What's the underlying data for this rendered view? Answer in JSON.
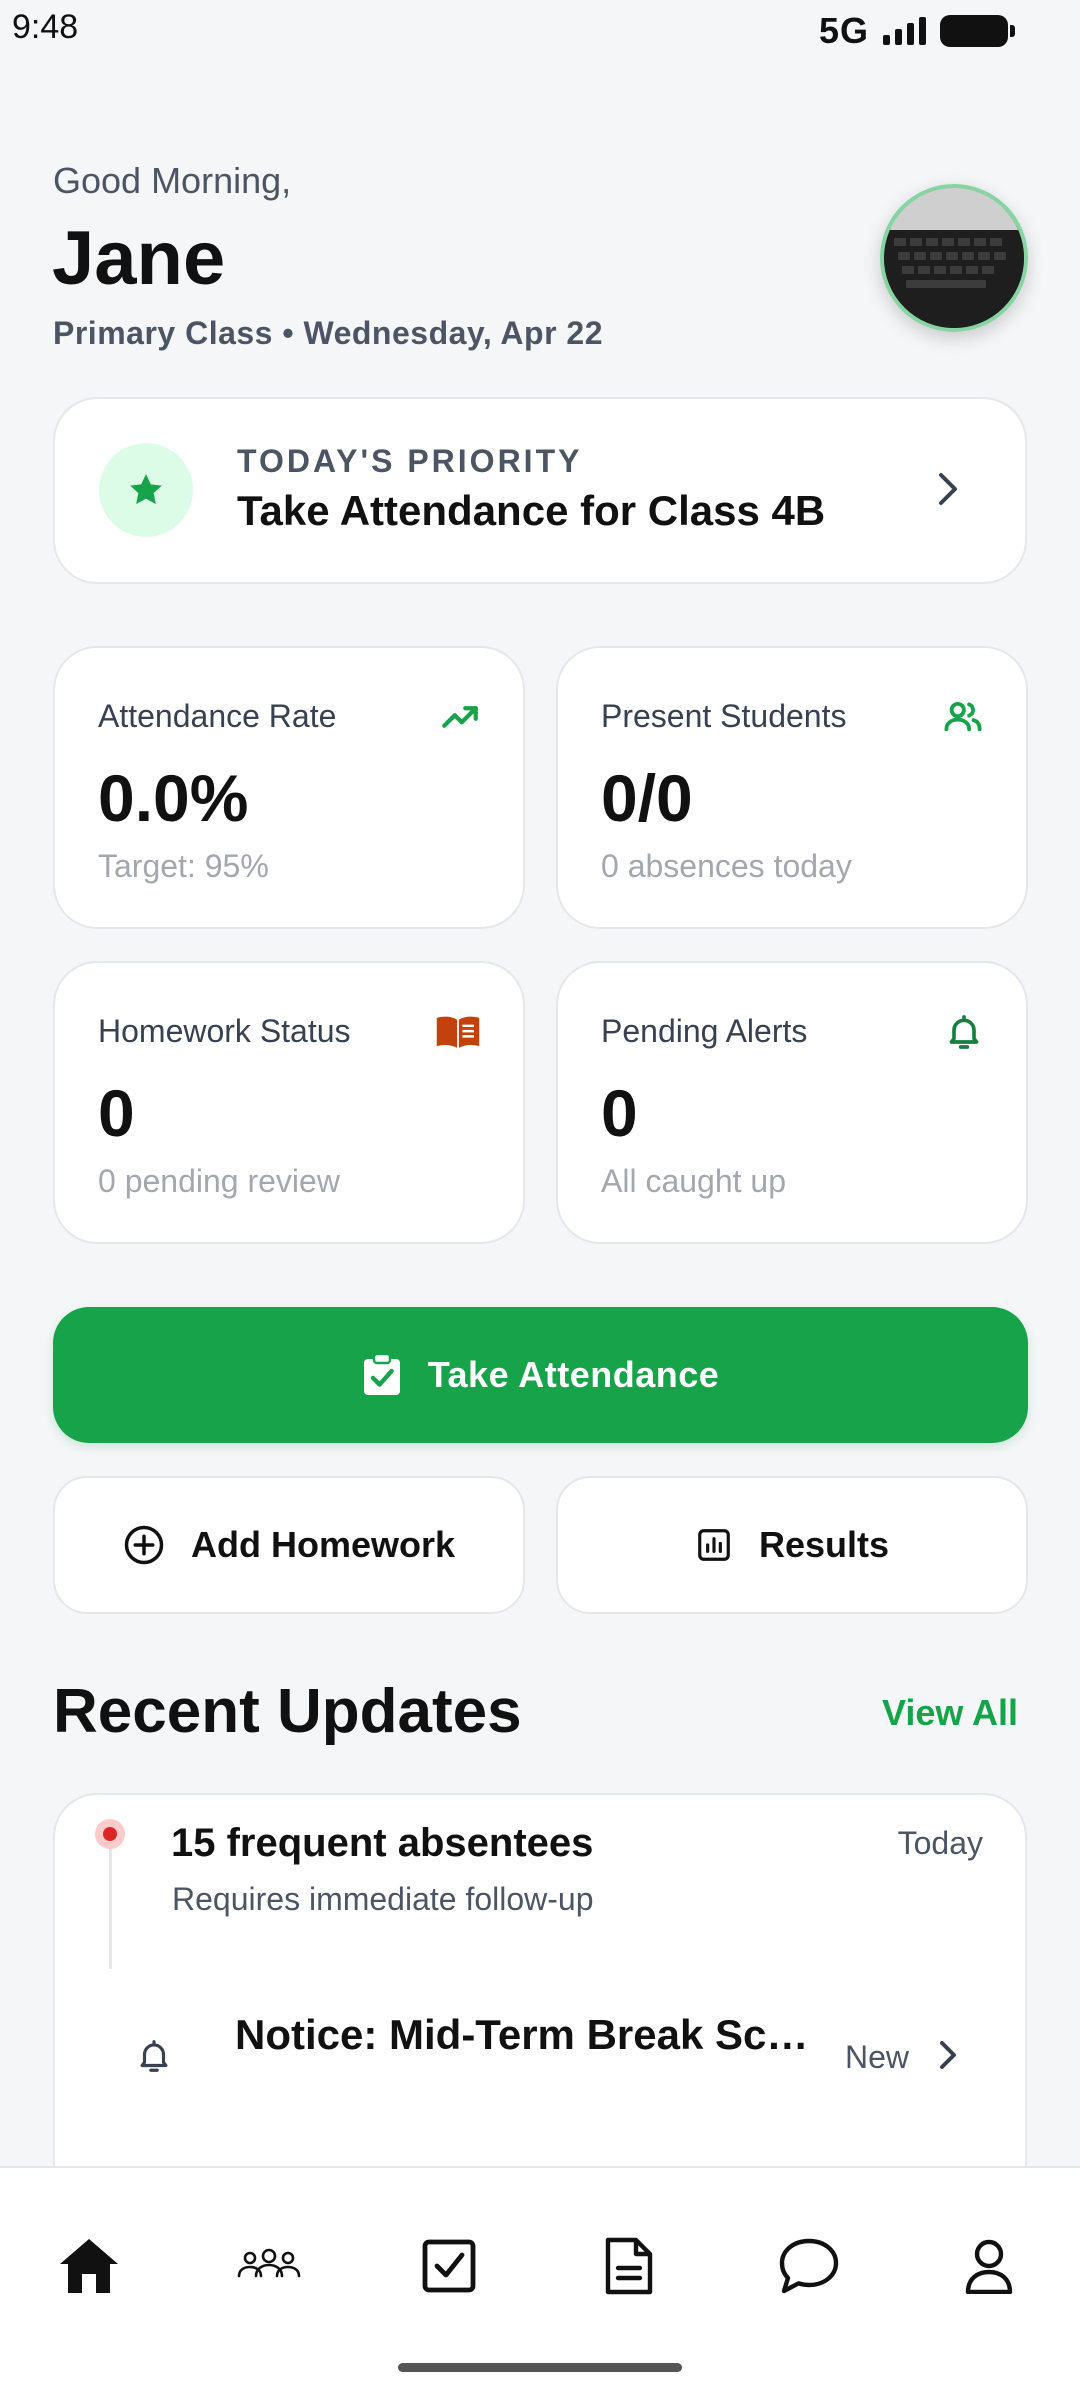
{
  "status_bar": {
    "time": "9:48",
    "network": "5G"
  },
  "header": {
    "greeting": "Good Morning,",
    "name": "Jane",
    "subline": "Primary Class • Wednesday, Apr 22",
    "avatar_icon": "profile-photo-laptop-keyboard"
  },
  "priority": {
    "label": "TODAY'S PRIORITY",
    "title": "Take Attendance for Class 4B",
    "icon": "star-icon"
  },
  "stats": [
    {
      "label": "Attendance Rate",
      "value": "0.0%",
      "sub": "Target: 95%",
      "icon": "trending-up-icon"
    },
    {
      "label": "Present Students",
      "value": "0/0",
      "sub": "0 absences today",
      "icon": "users-icon"
    },
    {
      "label": "Homework Status",
      "value": "0",
      "sub": "0 pending review",
      "icon": "book-icon"
    },
    {
      "label": "Pending Alerts",
      "value": "0",
      "sub": "All caught up",
      "icon": "bell-icon"
    }
  ],
  "actions": {
    "primary": "Take Attendance",
    "add_homework": "Add Homework",
    "results": "Results"
  },
  "recent_updates": {
    "title": "Recent Updates",
    "view_all": "View All",
    "items": [
      {
        "title": "15 frequent absentees",
        "subtitle": "Requires immediate follow-up",
        "time": "Today"
      },
      {
        "title": "Notice: Mid-Term Break Schedule",
        "tag": "New"
      }
    ]
  },
  "colors": {
    "accent": "#16A34A",
    "accent_light": "#DCFCE7",
    "alert": "#DC2626",
    "homework": "#C2410C",
    "background": "#F5F6F8"
  },
  "bottom_nav": [
    "home-icon",
    "students-icon",
    "attendance-icon",
    "documents-icon",
    "messages-icon",
    "profile-icon"
  ]
}
